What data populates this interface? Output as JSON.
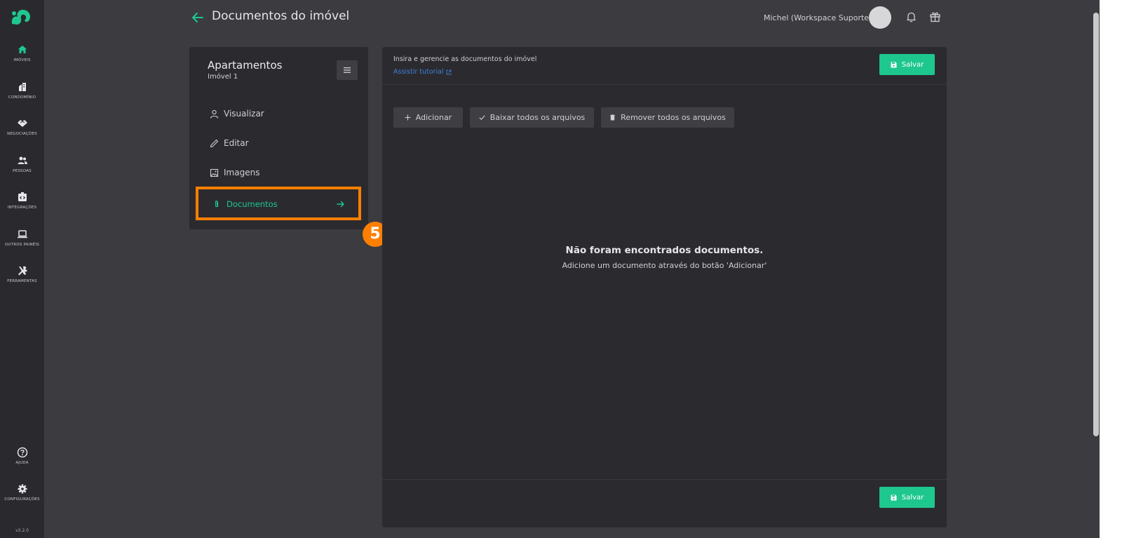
{
  "colors": {
    "accent": "#1ec78e",
    "highlight": "#ff7f00",
    "link": "#3f7fd4",
    "nav_bg": "#2a2a2e",
    "card_bg": "#2b2b2f",
    "page_bg": "#3b3b40"
  },
  "nav": {
    "items": [
      {
        "label": "IMÓVEIS",
        "icon": "home-icon"
      },
      {
        "label": "CONDOMÍNIO",
        "icon": "building-icon"
      },
      {
        "label": "NEGOCIAÇÕES",
        "icon": "handshake-icon"
      },
      {
        "label": "PESSOAS",
        "icon": "people-icon"
      },
      {
        "label": "INTEGRAÇÕES",
        "icon": "integration-icon"
      },
      {
        "label": "OUTROS PAINÉIS",
        "icon": "laptop-icon"
      },
      {
        "label": "FERRAMENTAS",
        "icon": "tools-icon"
      }
    ],
    "help": {
      "label": "AJUDA",
      "icon": "help-icon"
    },
    "settings": {
      "label": "CONFIGURAÇÕES",
      "icon": "gear-icon"
    },
    "version": "v3.2.0"
  },
  "header": {
    "title": "Documentos do imóvel",
    "user_name": "Michel (Workspace Suporte)"
  },
  "property": {
    "title": "Apartamentos",
    "subtitle": "Imóvel 1",
    "menu": [
      {
        "label": "Visualizar",
        "icon": "user-icon"
      },
      {
        "label": "Editar",
        "icon": "pencil-icon"
      },
      {
        "label": "Imagens",
        "icon": "image-icon"
      },
      {
        "label": "Documentos",
        "icon": "paperclip-icon",
        "active": true
      }
    ]
  },
  "step_badge": "5",
  "main": {
    "description": "Insira e gerencie as documentos do imóvel",
    "tutorial_link": "Assistir tutorial",
    "save_label": "Salvar",
    "toolbar": {
      "add": "Adicionar",
      "download_all": "Baixar todos os arquivos",
      "remove_all": "Remover todos os arquivos"
    },
    "empty_title": "Não foram encontrados documentos.",
    "empty_sub": "Adicione um documento através do botão 'Adicionar'"
  }
}
